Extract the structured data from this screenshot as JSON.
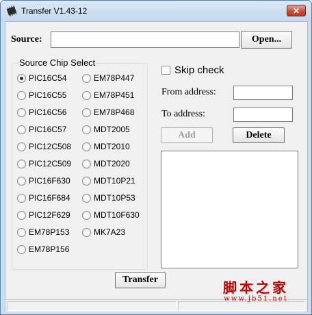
{
  "window": {
    "title": "Transfer V1.43-12",
    "close_label": "✕"
  },
  "source": {
    "label": "Source:",
    "value": "",
    "open_label": "Open..."
  },
  "chip_select": {
    "title": "Source Chip Select",
    "selected": "PIC16C54",
    "left_column": [
      "PIC16C54",
      "PIC16C55",
      "PIC16C56",
      "PIC16C57",
      "PIC12C508",
      "PIC12C509",
      "PIC16F630",
      "PIC16F684",
      "PIC12F629",
      "EM78P153",
      "EM78P156"
    ],
    "right_column": [
      "EM78P447",
      "EM78P451",
      "EM78P468",
      "MDT2005",
      "MDT2010",
      "MDT2020",
      "MDT10P21",
      "MDT10P53",
      "MDT10F630",
      "MK7A23"
    ]
  },
  "options": {
    "skip_check_label": "Skip check",
    "skip_check_checked": false,
    "from_address_label": "From address:",
    "from_address_value": "",
    "to_address_label": "To address:",
    "to_address_value": "",
    "add_label": "Add",
    "delete_label": "Delete"
  },
  "transfer_label": "Transfer",
  "watermark": {
    "title": "脚本之家",
    "url": "www.jb51.net"
  }
}
